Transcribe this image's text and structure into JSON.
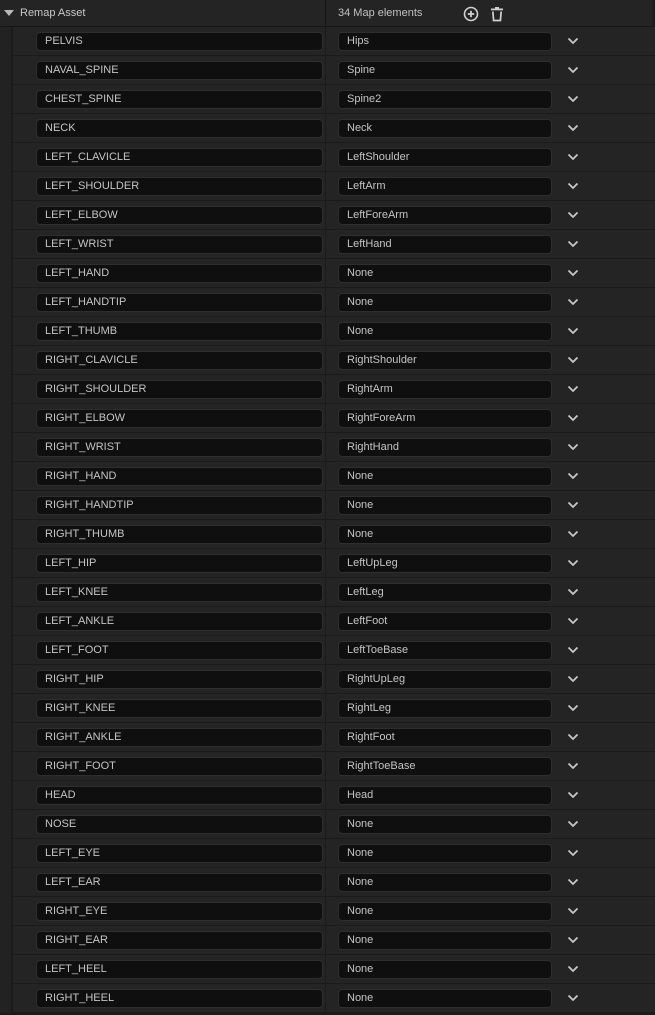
{
  "header": {
    "title": "Remap Asset",
    "count_label": "34 Map elements",
    "add_icon": "plus-circle-icon",
    "delete_icon": "trash-icon"
  },
  "colors": {
    "panel_bg": "#242424",
    "field_bg": "#0f0f0f",
    "text": "#c4c4c4"
  },
  "rows": [
    {
      "key": "PELVIS",
      "value": "Hips"
    },
    {
      "key": "NAVAL_SPINE",
      "value": "Spine"
    },
    {
      "key": "CHEST_SPINE",
      "value": "Spine2"
    },
    {
      "key": "NECK",
      "value": "Neck"
    },
    {
      "key": "LEFT_CLAVICLE",
      "value": "LeftShoulder"
    },
    {
      "key": "LEFT_SHOULDER",
      "value": "LeftArm"
    },
    {
      "key": "LEFT_ELBOW",
      "value": "LeftForeArm"
    },
    {
      "key": "LEFT_WRIST",
      "value": "LeftHand"
    },
    {
      "key": "LEFT_HAND",
      "value": "None"
    },
    {
      "key": "LEFT_HANDTIP",
      "value": "None"
    },
    {
      "key": "LEFT_THUMB",
      "value": "None"
    },
    {
      "key": "RIGHT_CLAVICLE",
      "value": "RightShoulder"
    },
    {
      "key": "RIGHT_SHOULDER",
      "value": "RightArm"
    },
    {
      "key": "RIGHT_ELBOW",
      "value": "RightForeArm"
    },
    {
      "key": "RIGHT_WRIST",
      "value": "RightHand"
    },
    {
      "key": "RIGHT_HAND",
      "value": "None"
    },
    {
      "key": "RIGHT_HANDTIP",
      "value": "None"
    },
    {
      "key": "RIGHT_THUMB",
      "value": "None"
    },
    {
      "key": "LEFT_HIP",
      "value": "LeftUpLeg"
    },
    {
      "key": "LEFT_KNEE",
      "value": "LeftLeg"
    },
    {
      "key": "LEFT_ANKLE",
      "value": "LeftFoot"
    },
    {
      "key": "LEFT_FOOT",
      "value": "LeftToeBase"
    },
    {
      "key": "RIGHT_HIP",
      "value": "RightUpLeg"
    },
    {
      "key": "RIGHT_KNEE",
      "value": "RightLeg"
    },
    {
      "key": "RIGHT_ANKLE",
      "value": "RightFoot"
    },
    {
      "key": "RIGHT_FOOT",
      "value": "RightToeBase"
    },
    {
      "key": "HEAD",
      "value": "Head"
    },
    {
      "key": "NOSE",
      "value": "None"
    },
    {
      "key": "LEFT_EYE",
      "value": "None"
    },
    {
      "key": "LEFT_EAR",
      "value": "None"
    },
    {
      "key": "RIGHT_EYE",
      "value": "None"
    },
    {
      "key": "RIGHT_EAR",
      "value": "None"
    },
    {
      "key": "LEFT_HEEL",
      "value": "None"
    },
    {
      "key": "RIGHT_HEEL",
      "value": "None"
    }
  ]
}
